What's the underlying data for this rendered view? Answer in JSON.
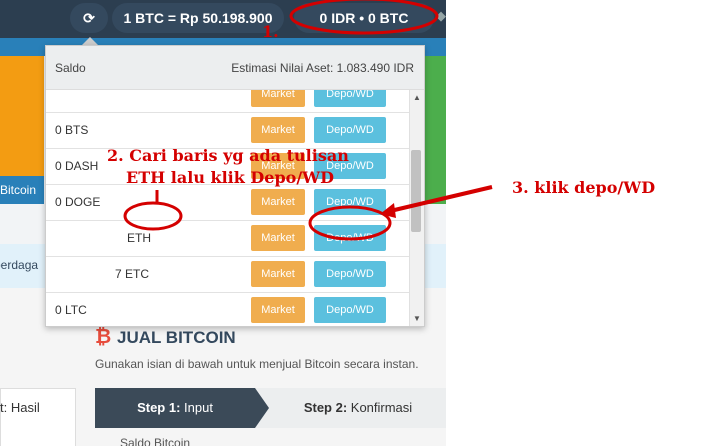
{
  "header": {
    "refresh_icon": "⟳",
    "rate": "1 BTC = Rp 50.198.900",
    "balance": "0 IDR  •  0 BTC",
    "bell_icon": "🔔"
  },
  "left": {
    "button_text": "n Bitcoin",
    "info_text": "perdaga"
  },
  "dropdown": {
    "saldo_label": "Saldo",
    "estimasi": "Estimasi Nilai Aset: 1.083.490 IDR",
    "rows": [
      {
        "coin": "",
        "market": "Market",
        "depo": "Depo/WD"
      },
      {
        "coin": "0 BTS",
        "market": "Market",
        "depo": "Depo/WD"
      },
      {
        "coin": "0 DASH",
        "market": "Market",
        "depo": "Depo/WD"
      },
      {
        "coin": "0 DOGE",
        "market": "Market",
        "depo": "Depo/WD"
      },
      {
        "coin": "ETH",
        "market": "Market",
        "depo": "Depo/WD"
      },
      {
        "coin": "7 ETC",
        "market": "Market",
        "depo": "Depo/WD"
      },
      {
        "coin": "0 LTC",
        "market": "Market",
        "depo": "Depo/WD"
      },
      {
        "coin": "",
        "market": "",
        "depo": ""
      }
    ],
    "scroll_up": "▲",
    "scroll_down": "▼"
  },
  "main": {
    "bitcoin_icon": "₿",
    "title": "JUAL BITCOIN",
    "subtitle": "Gunakan isian di bawah untuk menjual Bitcoin secara instan.",
    "hasil_label": "t: Hasil",
    "step1_label": "Step 1:",
    "step1_value": " Input",
    "step2_label": "Step 2:",
    "step2_value": " Konfirmasi",
    "bottom_text": "Saldo Bitcoin"
  },
  "annotations": {
    "step1": "1.",
    "step2_line1": "2. Cari baris yg ada tulisan",
    "step2_line2": "ETH lalu klik Depo/WD",
    "step3": "3. klik depo/WD",
    "color": "#d40000"
  }
}
